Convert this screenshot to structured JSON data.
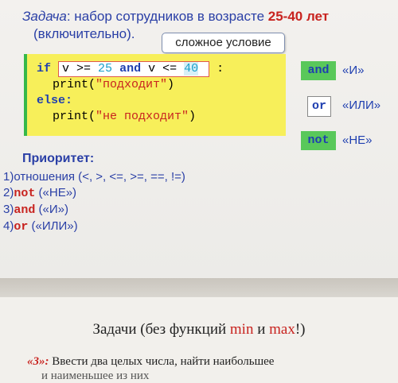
{
  "task": {
    "label": "Задача",
    "text": ": набор сотрудников в возрасте ",
    "range": "25-40 лет",
    "cont": "(включительно)."
  },
  "note": "сложное условие",
  "code": {
    "if": "if",
    "cond_a": "v >= ",
    "n25": "25",
    "and": "and",
    "cond_b": " v <= ",
    "n40": "40",
    "colon": ":",
    "print1_fn": "print(",
    "print1_str": "\"подходит\"",
    "print1_end": ")",
    "else": "else:",
    "print2_fn": "print(",
    "print2_str": "\"не подходит\"",
    "print2_end": ")"
  },
  "ops": [
    {
      "kw": "and",
      "desc": "«И»"
    },
    {
      "kw": "or",
      "desc": "«ИЛИ»"
    },
    {
      "kw": "not",
      "desc": "«НЕ»"
    }
  ],
  "priority": {
    "heading": "Приоритет:",
    "items": [
      {
        "num": "1)",
        "text": "отношения (",
        "ops": "<, >, <=, >=, ==, !=",
        "end": ")"
      },
      {
        "num": "2)",
        "kw": "not",
        "text": " («НЕ»)"
      },
      {
        "num": "3)",
        "kw": "and",
        "text": " («И»)"
      },
      {
        "num": "4)",
        "kw": "or",
        "text": " («ИЛИ»)"
      }
    ]
  },
  "slide2": {
    "title_a": "Задачи (без функций ",
    "min": "min",
    "title_b": " и ",
    "max": "max",
    "title_c": "!)",
    "task_num": "«3»:",
    "task_text": " Ввести два целых числа, найти наибольшее",
    "task_cut": "и наименьшее из них"
  }
}
